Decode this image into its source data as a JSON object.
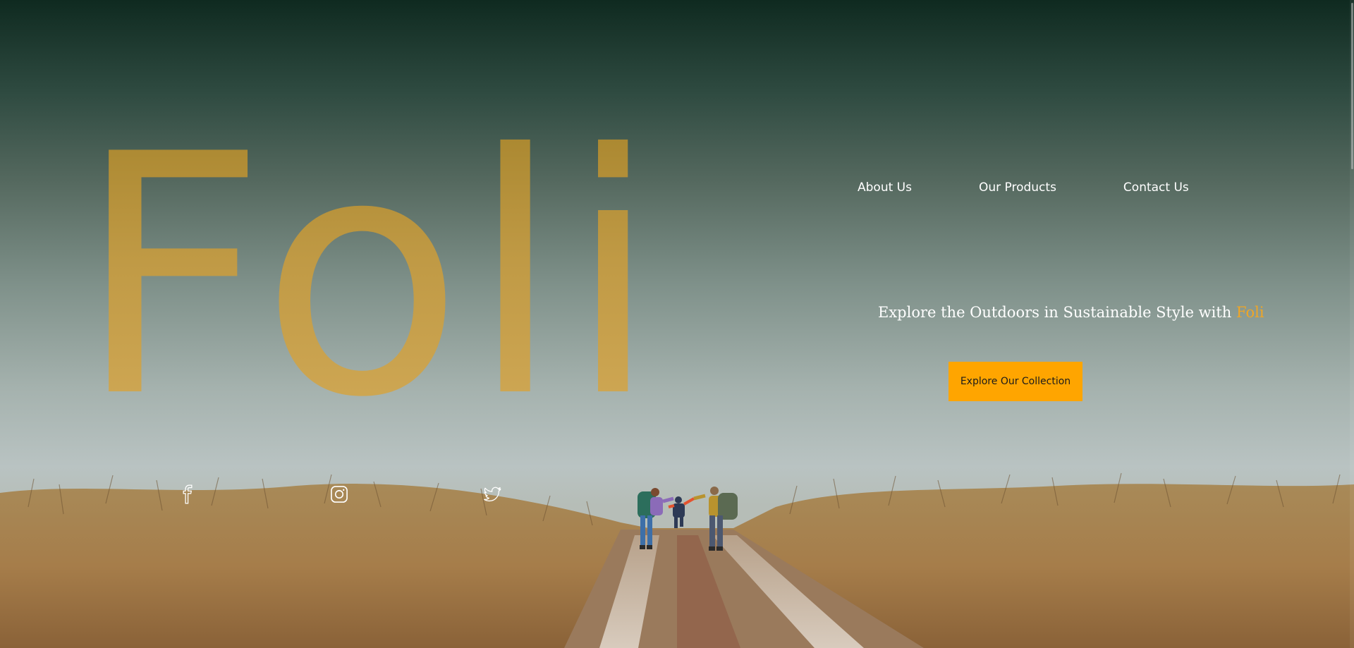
{
  "brand": {
    "name": "Foli"
  },
  "nav": {
    "items": [
      {
        "label": "About Us"
      },
      {
        "label": "Our Products"
      },
      {
        "label": "Contact Us"
      }
    ]
  },
  "hero": {
    "tagline": "Explore the Outdoors in Sustainable Style with",
    "tagline_accent": "Foli",
    "cta_label": "Explore Our Collection"
  },
  "social": {
    "icons": [
      "facebook-icon",
      "instagram-icon",
      "twitter-icon"
    ]
  },
  "colors": {
    "accent": "#ffa500",
    "brand_gold": "#c09a45",
    "background_top": "#0f2a20",
    "background_bottom": "#b9c3c2"
  }
}
